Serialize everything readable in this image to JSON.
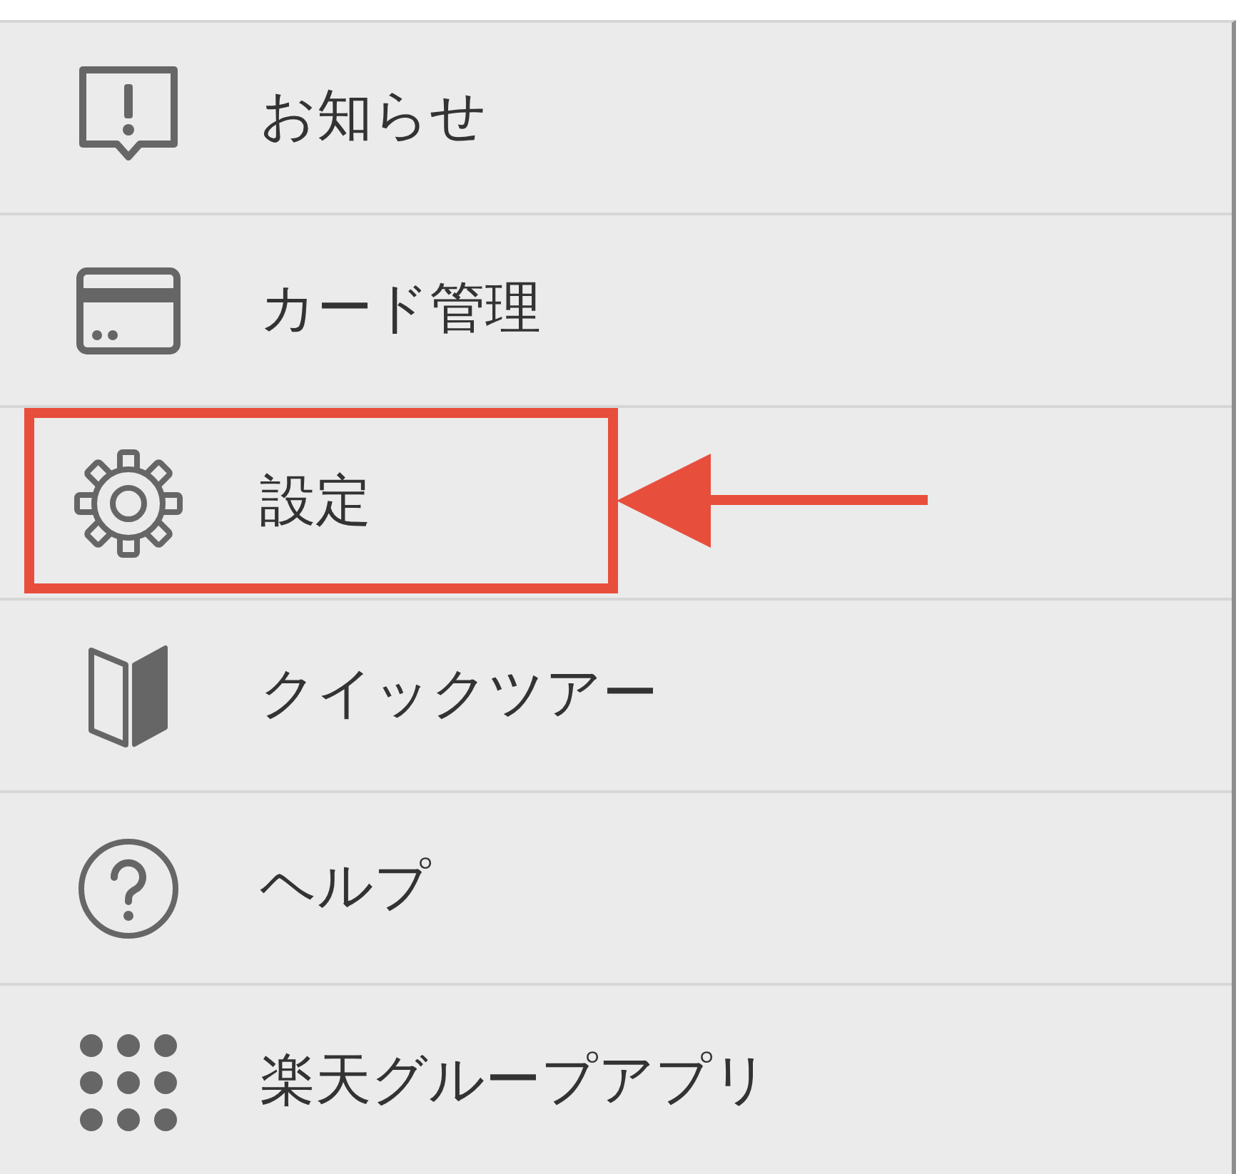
{
  "menu": {
    "items": [
      {
        "label": "お知らせ",
        "highlighted": false
      },
      {
        "label": "カード管理",
        "highlighted": false
      },
      {
        "label": "設定",
        "highlighted": true
      },
      {
        "label": "クイックツアー",
        "highlighted": false
      },
      {
        "label": "ヘルプ",
        "highlighted": false
      },
      {
        "label": "楽天グループアプリ",
        "highlighted": false
      }
    ]
  }
}
